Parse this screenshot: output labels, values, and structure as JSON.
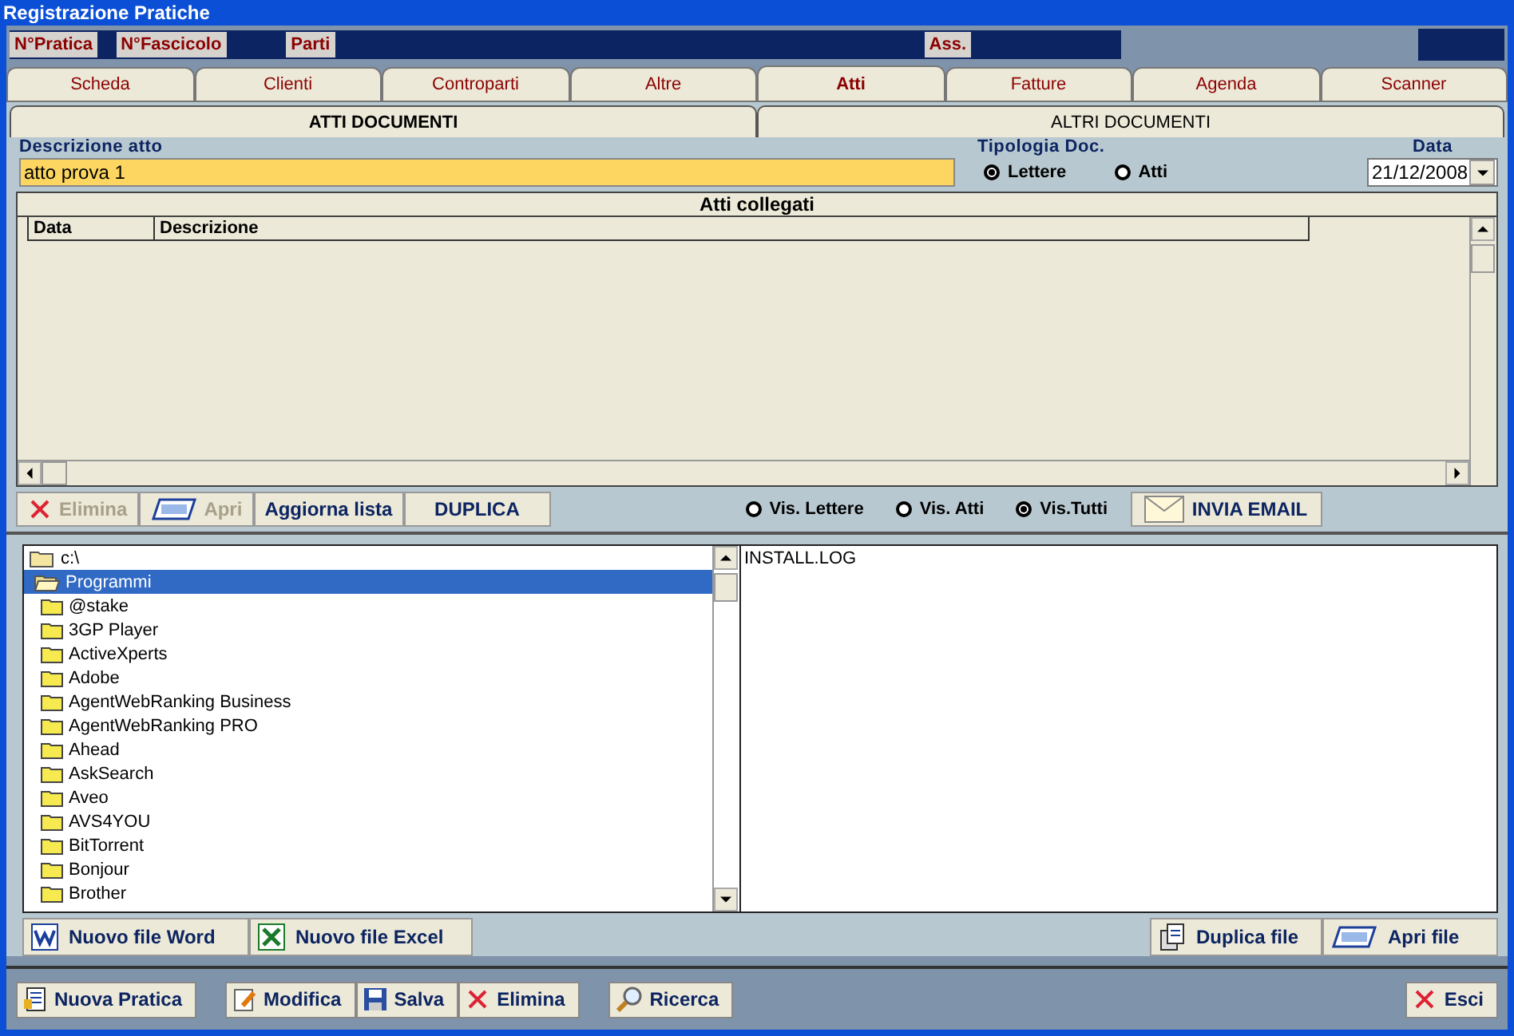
{
  "window": {
    "title": "Registrazione Pratiche"
  },
  "header_fields": [
    {
      "label": "N°Pratica"
    },
    {
      "label": "N°Fascicolo"
    },
    {
      "label": "Parti"
    },
    {
      "label": "Ass."
    }
  ],
  "tabs": [
    {
      "label": "Scheda",
      "selected": false
    },
    {
      "label": "Clienti",
      "selected": false
    },
    {
      "label": "Controparti",
      "selected": false
    },
    {
      "label": "Altre",
      "selected": false
    },
    {
      "label": "Atti",
      "selected": true
    },
    {
      "label": "Fatture",
      "selected": false
    },
    {
      "label": "Agenda",
      "selected": false
    },
    {
      "label": "Scanner",
      "selected": false
    }
  ],
  "subtabs": [
    {
      "label": "ATTI DOCUMENTI",
      "selected": true
    },
    {
      "label": "ALTRI DOCUMENTI",
      "selected": false
    }
  ],
  "form": {
    "description_label": "Descrizione atto",
    "description_value": "atto prova 1",
    "type_label": "Tipologia Doc.",
    "type_options": [
      {
        "label": "Lettere",
        "selected": true
      },
      {
        "label": "Atti",
        "selected": false
      }
    ],
    "date_label": "Data",
    "date_value": "21/12/2008"
  },
  "grid": {
    "title": "Atti collegati",
    "columns": [
      "Data",
      "Descrizione"
    ]
  },
  "toolbar": {
    "buttons": [
      {
        "label": "Elimina",
        "disabled": true
      },
      {
        "label": "Apri",
        "disabled": true
      },
      {
        "label": "Aggiorna lista",
        "disabled": false
      },
      {
        "label": "DUPLICA",
        "disabled": false
      }
    ],
    "view_options": [
      {
        "label": "Vis. Lettere",
        "selected": false
      },
      {
        "label": "Vis. Atti",
        "selected": false
      },
      {
        "label": "Vis.Tutti",
        "selected": true
      }
    ],
    "email_button": "INVIA EMAIL"
  },
  "folders": [
    {
      "name": "c:\\",
      "kind": "drive",
      "selected": false
    },
    {
      "name": "Programmi",
      "kind": "open",
      "selected": true
    },
    {
      "name": "@stake",
      "kind": "folder",
      "selected": false
    },
    {
      "name": "3GP Player",
      "kind": "folder",
      "selected": false
    },
    {
      "name": "ActiveXperts",
      "kind": "folder",
      "selected": false
    },
    {
      "name": "Adobe",
      "kind": "folder",
      "selected": false
    },
    {
      "name": "AgentWebRanking Business",
      "kind": "folder",
      "selected": false
    },
    {
      "name": "AgentWebRanking PRO",
      "kind": "folder",
      "selected": false
    },
    {
      "name": "Ahead",
      "kind": "folder",
      "selected": false
    },
    {
      "name": "AskSearch",
      "kind": "folder",
      "selected": false
    },
    {
      "name": "Aveo",
      "kind": "folder",
      "selected": false
    },
    {
      "name": "AVS4YOU",
      "kind": "folder",
      "selected": false
    },
    {
      "name": "BitTorrent",
      "kind": "folder",
      "selected": false
    },
    {
      "name": "Bonjour",
      "kind": "folder",
      "selected": false
    },
    {
      "name": "Brother",
      "kind": "folder",
      "selected": false
    }
  ],
  "files": [
    "INSTALL.LOG"
  ],
  "file_buttons_left": [
    "Nuovo file Word",
    "Nuovo file Excel"
  ],
  "file_buttons_right": [
    "Duplica file",
    "Apri file"
  ],
  "footer_buttons": [
    "Nuova Pratica",
    "Modifica",
    "Salva",
    "Elimina",
    "Ricerca"
  ],
  "exit_button": "Esci"
}
